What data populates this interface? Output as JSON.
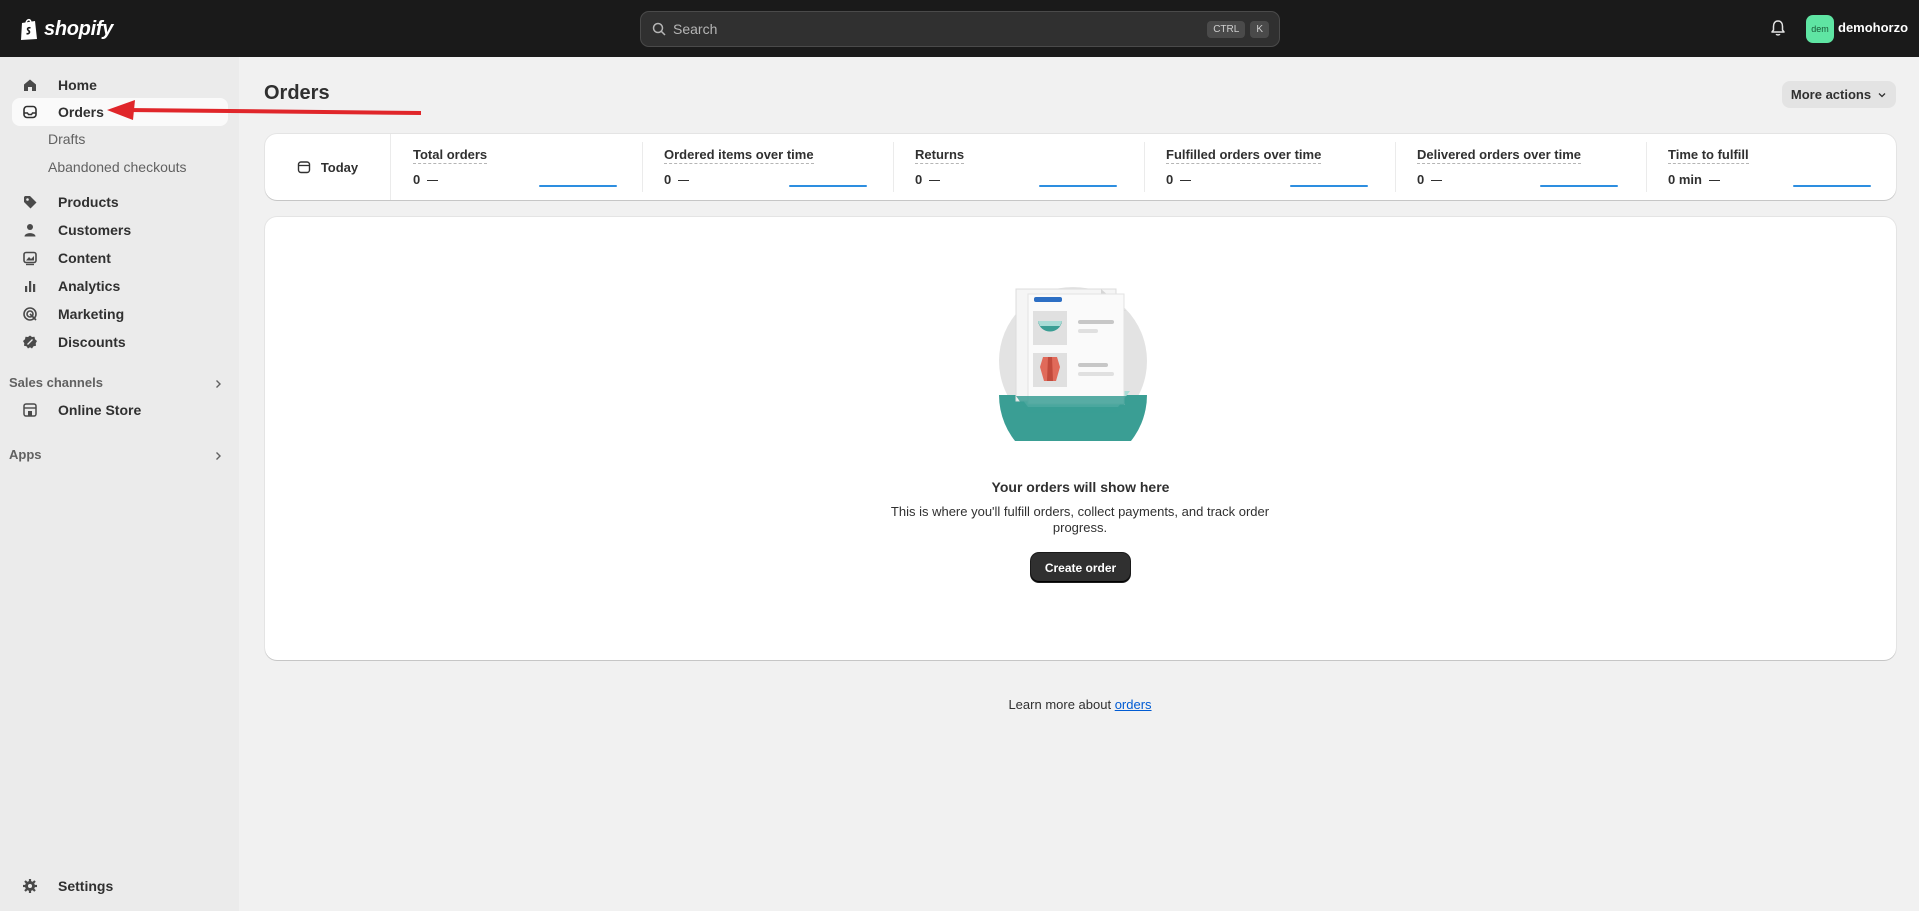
{
  "topbar": {
    "brand": "shopify",
    "search_placeholder": "Search",
    "shortcut_keys": [
      "CTRL",
      "K"
    ],
    "avatar_initials": "dem",
    "username": "demohorzo",
    "avatar_color": "#5fe5a3"
  },
  "sidebar": {
    "items": [
      {
        "label": "Home",
        "icon": "home-icon"
      },
      {
        "label": "Orders",
        "icon": "orders-inbox-icon",
        "active": true
      },
      {
        "label": "Products",
        "icon": "tag-icon"
      },
      {
        "label": "Customers",
        "icon": "person-icon"
      },
      {
        "label": "Content",
        "icon": "content-icon"
      },
      {
        "label": "Analytics",
        "icon": "bar-chart-icon"
      },
      {
        "label": "Marketing",
        "icon": "target-icon"
      },
      {
        "label": "Discounts",
        "icon": "discount-icon"
      }
    ],
    "orders_subitems": [
      "Drafts",
      "Abandoned checkouts"
    ],
    "sales_channels_label": "Sales channels",
    "online_store_label": "Online Store",
    "apps_label": "Apps",
    "settings_label": "Settings"
  },
  "main": {
    "title": "Orders",
    "more_actions_label": "More actions",
    "date_filter_label": "Today",
    "metrics": [
      {
        "label": "Total orders",
        "value": "0"
      },
      {
        "label": "Ordered items over time",
        "value": "0"
      },
      {
        "label": "Returns",
        "value": "0"
      },
      {
        "label": "Fulfilled orders over time",
        "value": "0"
      },
      {
        "label": "Delivered orders over time",
        "value": "0"
      },
      {
        "label": "Time to fulfill",
        "value": "0 min"
      }
    ],
    "empty_state": {
      "title": "Your orders will show here",
      "description": "This is where you'll fulfill orders, collect payments, and track order progress.",
      "button_label": "Create order"
    },
    "learn_more_prefix": "Learn more about ",
    "learn_more_link": "orders"
  },
  "colors": {
    "accent_link": "#005bd3",
    "spark_line": "#2d8ee0",
    "annotation_arrow": "#e0262a"
  }
}
